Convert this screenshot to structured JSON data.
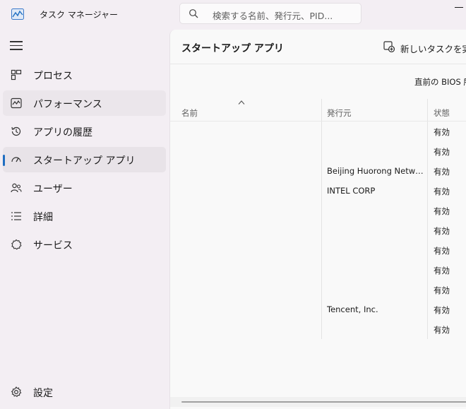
{
  "app": {
    "title": "タスク マネージャー"
  },
  "search": {
    "placeholder": "検索する名前、発行元、PID..."
  },
  "sidebar": {
    "items": [
      {
        "label": "プロセス",
        "icon": "processes-icon"
      },
      {
        "label": "パフォーマンス",
        "icon": "performance-icon"
      },
      {
        "label": "アプリの履歴",
        "icon": "app-history-icon"
      },
      {
        "label": "スタートアップ アプリ",
        "icon": "startup-icon"
      },
      {
        "label": "ユーザー",
        "icon": "users-icon"
      },
      {
        "label": "詳細",
        "icon": "details-icon"
      },
      {
        "label": "サービス",
        "icon": "services-icon"
      }
    ],
    "settings_label": "設定"
  },
  "main": {
    "title": "スタートアップ アプリ",
    "new_task_label": "新しいタスクを実",
    "bios_text": "直前の BIOS 所"
  },
  "table": {
    "columns": [
      "名前",
      "発行元",
      "状態"
    ],
    "rows": [
      {
        "name": "",
        "publisher": "",
        "state": "有効"
      },
      {
        "name": "",
        "publisher": "",
        "state": "有効"
      },
      {
        "name": "",
        "publisher": "Beijing Huorong Netwo...",
        "state": "有効"
      },
      {
        "name": "",
        "publisher": "INTEL CORP",
        "state": "有効"
      },
      {
        "name": "",
        "publisher": "",
        "state": "有効"
      },
      {
        "name": "",
        "publisher": "",
        "state": "有効"
      },
      {
        "name": "",
        "publisher": "",
        "state": "有効"
      },
      {
        "name": "",
        "publisher": "",
        "state": "有効"
      },
      {
        "name": "",
        "publisher": "",
        "state": "有効"
      },
      {
        "name": "",
        "publisher": "Tencent, Inc.",
        "state": "有効"
      },
      {
        "name": "",
        "publisher": "",
        "state": "有効"
      }
    ]
  },
  "colors": {
    "accent": "#1f6ec1",
    "background": "#f3eef3",
    "content": "#f9f9f9"
  }
}
